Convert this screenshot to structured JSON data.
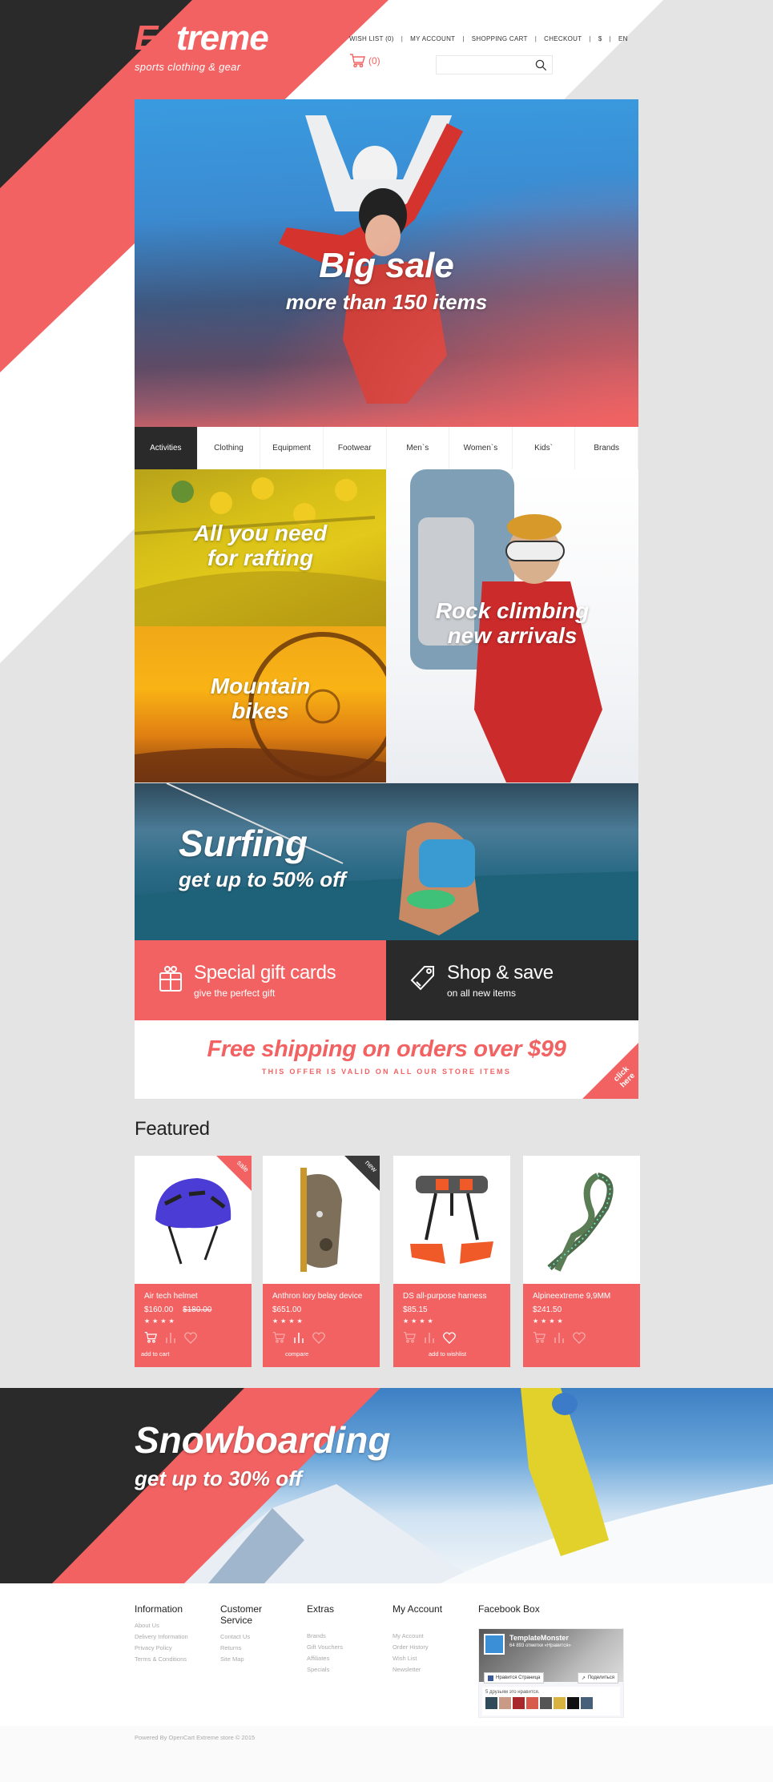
{
  "theme": {
    "accent": "#f36262",
    "dark": "#2a2a2a",
    "grey_bg": "#e4e4e4"
  },
  "header": {
    "logo_prefix": "Ex",
    "logo_rest": "treme",
    "tagline": "sports clothing & gear",
    "top_links": [
      "WISH LIST (0)",
      "MY ACCOUNT",
      "SHOPPING CART",
      "CHECKOUT",
      "$",
      "EN"
    ],
    "cart_count": "(0)",
    "cart_icon": "cart-icon",
    "search": {
      "placeholder": "",
      "value": "",
      "icon": "search-icon"
    }
  },
  "hero": {
    "title": "Big sale",
    "subtitle": "more than 150 items"
  },
  "category_nav": {
    "active": "Activities",
    "items": [
      "Activities",
      "Clothing",
      "Equipment",
      "Footwear",
      "Men`s",
      "Women`s",
      "Kids`",
      "Brands"
    ]
  },
  "tiles": {
    "rafting": {
      "line1": "All you need",
      "line2": "for rafting"
    },
    "bikes": {
      "line1": "Mountain",
      "line2": "bikes"
    },
    "climbing": {
      "line1": "Rock climbing",
      "line2": "new arrivals"
    },
    "surfing": {
      "line1": "Surfing",
      "line2": "get up to 50% off"
    }
  },
  "promos": {
    "gift": {
      "title": "Special gift cards",
      "subtitle": "give the perfect gift",
      "icon": "gift-icon"
    },
    "shop": {
      "title": "Shop & save",
      "subtitle": "on all new items",
      "icon": "tag-icon"
    }
  },
  "shipping": {
    "title": "Free shipping on orders over $99",
    "subtitle": "THIS OFFER IS VALID ON ALL OUR STORE ITEMS",
    "corner_line1": "click",
    "corner_line2": "here"
  },
  "featured": {
    "title": "Featured",
    "products": [
      {
        "name": "Air tech helmet",
        "price": "$160.00",
        "old_price": "$180.00",
        "rating": 4,
        "stars": "★★★★",
        "badge": "sale",
        "tooltip": "add to cart",
        "active_action": "cart"
      },
      {
        "name": "Anthron lory belay device",
        "price": "$651.00",
        "old_price": "",
        "rating": 4,
        "stars": "★★★★",
        "badge": "new",
        "tooltip": "compare",
        "active_action": "compare"
      },
      {
        "name": "DS all-purpose harness",
        "price": "$85.15",
        "old_price": "",
        "rating": 4,
        "stars": "★★★★",
        "badge": "",
        "tooltip": "add to wishlist",
        "active_action": "wishlist"
      },
      {
        "name": "Alpineextreme 9,9MM",
        "price": "$241.50",
        "old_price": "",
        "rating": 4,
        "stars": "★★★★",
        "badge": "",
        "tooltip": "",
        "active_action": ""
      }
    ]
  },
  "snowboard": {
    "title": "Snowboarding",
    "subtitle": "get up to 30% off"
  },
  "footer": {
    "columns": [
      {
        "title": "Information",
        "links": [
          "About Us",
          "Delivery Information",
          "Privacy Policy",
          "Terms & Conditions"
        ]
      },
      {
        "title": "Customer Service",
        "links": [
          "Contact Us",
          "Returns",
          "Site Map"
        ]
      },
      {
        "title": "Extras",
        "links": [
          "Brands",
          "Gift Vouchers",
          "Affiliates",
          "Specials"
        ]
      },
      {
        "title": "My Account",
        "links": [
          "My Account",
          "Order History",
          "Wish List",
          "Newsletter"
        ]
      }
    ],
    "facebook": {
      "title": "Facebook Box",
      "page_name": "TemplateMonster",
      "likes": "64 893 отметки «Нравится»",
      "like_button": "Нравится Страница",
      "share_button": "Поделиться",
      "friends_text": "5 друзьям это нравится."
    },
    "copyright": "Powered By OpenCart Extreme store © 2015"
  }
}
